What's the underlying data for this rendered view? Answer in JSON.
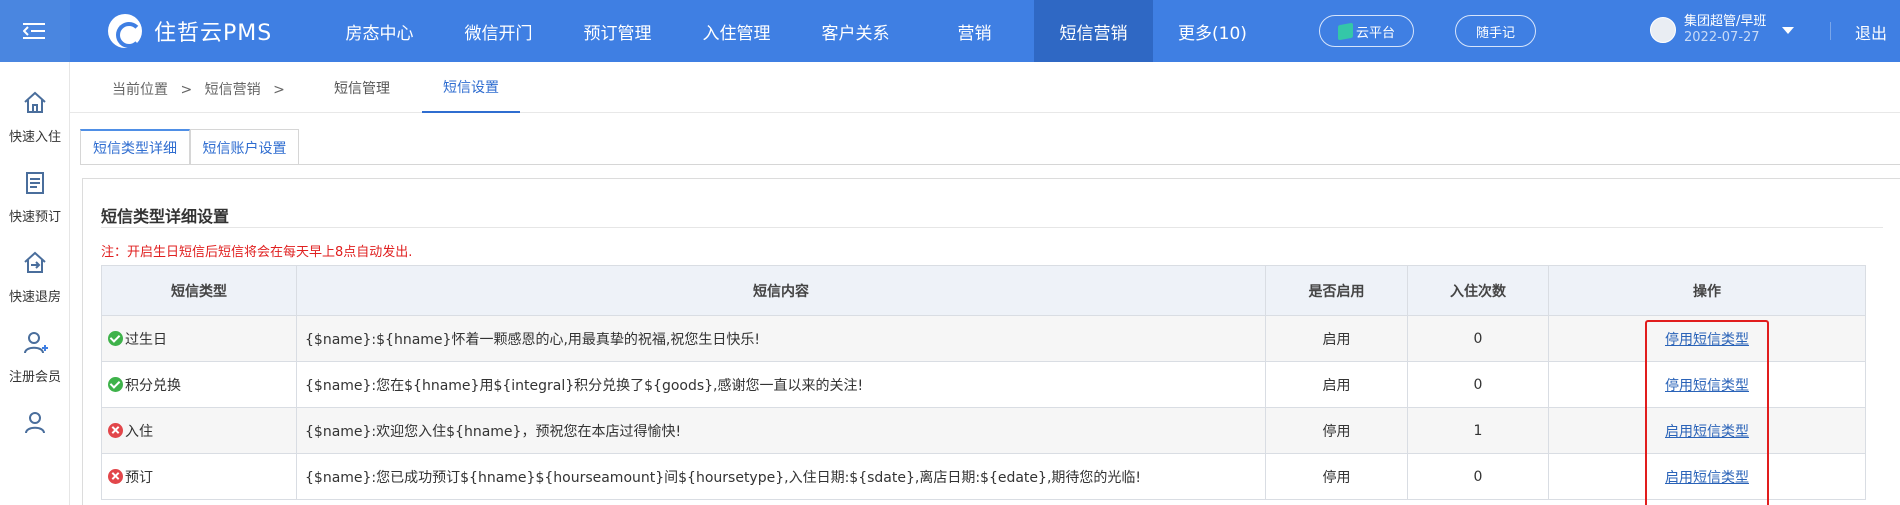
{
  "brand": {
    "name": "住哲云PMS",
    "primary_color": "#3f7fe3",
    "active_nav_color": "#2f68c4"
  },
  "nav": {
    "items": [
      {
        "label": "房态中心"
      },
      {
        "label": "微信开门"
      },
      {
        "label": "预订管理"
      },
      {
        "label": "入住管理"
      },
      {
        "label": "客户关系"
      },
      {
        "label": "营销"
      },
      {
        "label": "短信营销",
        "active": true
      },
      {
        "label": "更多(10)"
      }
    ]
  },
  "header_right": {
    "cloud_label": "云平台",
    "notes_label": "随手记",
    "user_name": "集团超管/早班",
    "user_date": "2022-07-27",
    "logout_label": "退出"
  },
  "sidebar": {
    "items": [
      {
        "label": "快速入住",
        "icon": "home-icon"
      },
      {
        "label": "快速预订",
        "icon": "clipboard-icon"
      },
      {
        "label": "快速退房",
        "icon": "checkout-icon"
      },
      {
        "label": "注册会员",
        "icon": "add-user-icon"
      }
    ]
  },
  "breadcrumb": {
    "current_label": "当前位置",
    "separator": ">",
    "section": "短信营销",
    "separator2": ">"
  },
  "top_tabs": [
    {
      "label": "短信管理"
    },
    {
      "label": "短信设置",
      "active": true
    }
  ],
  "inner_tabs": [
    {
      "label": "短信类型详细",
      "active": true
    },
    {
      "label": "短信账户设置"
    }
  ],
  "panel": {
    "title": "短信类型详细设置",
    "notice": "注：开启生日短信后短信将会在每天早上8点自动发出."
  },
  "table": {
    "headers": [
      "短信类型",
      "短信内容",
      "是否启用",
      "入住次数",
      "操作"
    ],
    "rows": [
      {
        "type": "过生日",
        "enabled": true,
        "content": "{$name}:${hname}怀着一颗感恩的心,用最真挚的祝福,祝您生日快乐!",
        "status": "启用",
        "count": "0",
        "action": "停用短信类型"
      },
      {
        "type": "积分兑换",
        "enabled": true,
        "content": "{$name}:您在${hname}用${integral}积分兑换了${goods},感谢您一直以来的关注!",
        "status": "启用",
        "count": "0",
        "action": "停用短信类型"
      },
      {
        "type": "入住",
        "enabled": false,
        "content": "{$name}:欢迎您入住${hname}，预祝您在本店过得愉快!",
        "status": "停用",
        "count": "1",
        "action": "启用短信类型"
      },
      {
        "type": "预订",
        "enabled": false,
        "content": "{$name}:您已成功预订${hname}${hourseamount}间${hoursetype},入住日期:${sdate},离店日期:${edate},期待您的光临!",
        "status": "停用",
        "count": "0",
        "action": "启用短信类型"
      }
    ]
  },
  "colors": {
    "enabled_icon": "#3eb24a",
    "disabled_icon": "#e2464a",
    "notice_red": "#e02020",
    "highlight_box": "#e11d1d",
    "link_blue": "#2a63b8"
  }
}
